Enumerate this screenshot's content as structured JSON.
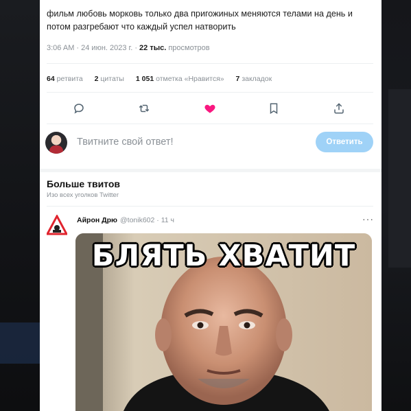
{
  "tweet": {
    "text": "фильм любовь морковь только два пригожиных меняются телами на день и потом разгребают что каждый успел натворить",
    "time_date": "3:06 AM · 24 июн. 2023 г. · ",
    "views_count": "22 тыс.",
    "views_label": " просмотров"
  },
  "stats": {
    "retweets_num": "64",
    "retweets_label": "ретвита",
    "quotes_num": "2",
    "quotes_label": "цитаты",
    "likes_num": "1 051",
    "likes_label": "отметка «Нравится»",
    "bookmarks_num": "7",
    "bookmarks_label": "закладок"
  },
  "actions": {
    "icons": [
      "reply-icon",
      "retweet-icon",
      "heart-icon",
      "bookmark-icon",
      "share-icon"
    ],
    "like_color": "#f91880",
    "icon_color": "#536471"
  },
  "reply": {
    "placeholder": "Твитните свой ответ!",
    "button_label": "Ответить",
    "button_color": "#9fd2f7"
  },
  "more_tweets": {
    "title": "Больше твитов",
    "subtitle": "Изо всех уголков Twitter"
  },
  "recommended_tweet": {
    "author_name": "Айрон Дрю",
    "meta": "@tonik602 · 11 ч",
    "more_label": "···",
    "image_caption": "БЛЯТЬ ХВАТИТ"
  }
}
